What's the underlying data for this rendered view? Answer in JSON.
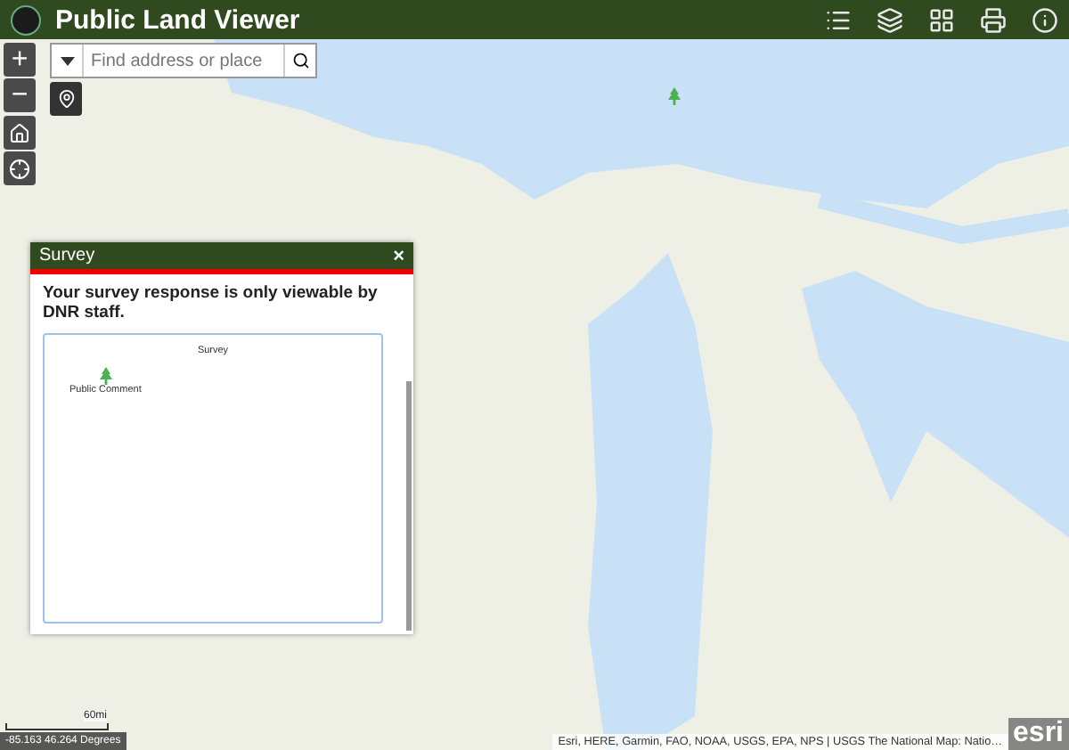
{
  "app_bar": {
    "title": "Public Land Viewer"
  },
  "search": {
    "placeholder": "Find address or place"
  },
  "zoom_controls": [
    "+",
    "−"
  ],
  "panel": {
    "title": "Survey",
    "close": "×",
    "message": "Your survey response is only viewable by DNR staff.",
    "form": {
      "title": "Survey",
      "items": [
        {
          "label": "Public Comment"
        }
      ]
    }
  },
  "scale": {
    "label": "60mi"
  },
  "coordinates": "-85.163 46.264 Degrees",
  "attribution": "Esri, HERE, Garmin, FAO, NOAA, USGS, EPA, NPS | USGS The National Map: Natio…",
  "logo": "esri"
}
